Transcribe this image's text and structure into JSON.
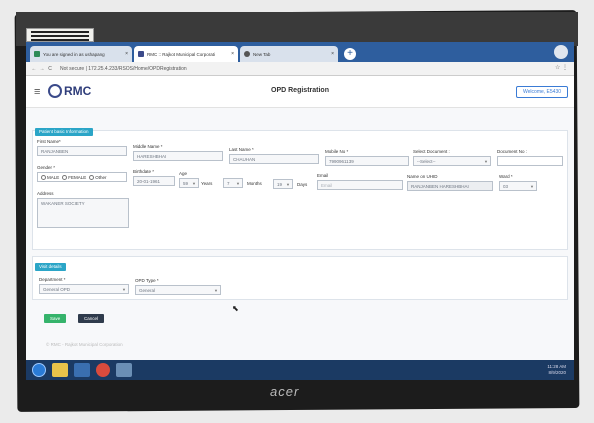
{
  "browser": {
    "tabs": [
      {
        "label": "You are signed in as ushapang",
        "active": false
      },
      {
        "label": "RMC :: Rajkot Municipal Corporati",
        "active": true
      },
      {
        "label": "New Tab",
        "active": false
      }
    ],
    "new_tab_symbol": "+",
    "url": "Not secure | 172.25.4.233/RSOS/Home/OPDRegistration",
    "nav_icons": [
      "back-icon",
      "forward-icon",
      "reload-icon"
    ]
  },
  "app": {
    "menu_icon": "≡",
    "logo_text": "RMC",
    "page_title": "OPD Registration",
    "welcome_text": "Welcome, E5430"
  },
  "patient_section": {
    "heading": "Patient basic Information",
    "first_name_label": "First Name*",
    "first_name_value": "RANJANBEN",
    "middle_name_label": "Middle Name *",
    "middle_name_value": "HARESHBHAI",
    "last_name_label": "Last Name *",
    "last_name_value": "CHAUHAN",
    "mobile_label": "Mobile No *",
    "mobile_value": "7990961139",
    "select_document_label": "Select Document :",
    "select_document_value": "--Select--",
    "document_no_label": "Document No :",
    "document_no_value": "",
    "gender_label": "Gender *",
    "gender_options": [
      "MALE",
      "FEMALE",
      "Other"
    ],
    "birthdate_label": "Birthdate *",
    "birthdate_value": "20-01-1961",
    "age_label": "Age",
    "age_years": "59",
    "years_label": "Years",
    "age_months": "7",
    "months_label": "Months",
    "age_days": "19",
    "days_label": "Days",
    "email_label": "Email",
    "email_placeholder": "Email",
    "name_on_uhid_label": "Name on UHID",
    "name_on_uhid_value": "RANJANBEN HARESHBHAI",
    "ward_label": "Ward *",
    "ward_value": "03",
    "address_label": "Address",
    "address_value": "WAKANER SOCIETY"
  },
  "visit_section": {
    "heading": "Visit details",
    "department_label": "Department *",
    "department_value": "General OPD",
    "opd_type_label": "OPD Type *",
    "opd_type_value": "General"
  },
  "actions": {
    "save_label": "Save",
    "cancel_label": "Cancel"
  },
  "footer_text": "© RMC - Rajkot Municipal Corporation",
  "taskbar": {
    "time": "11:28 AM",
    "date": "8/9/2020"
  },
  "monitor_brand": "acer",
  "colors": {
    "section_heading": "#2ba5c7",
    "save_button": "#35b36b",
    "cancel_button": "#2f3b4c",
    "tab_bar": "#2e5e9e",
    "taskbar": "#1b3a63"
  }
}
